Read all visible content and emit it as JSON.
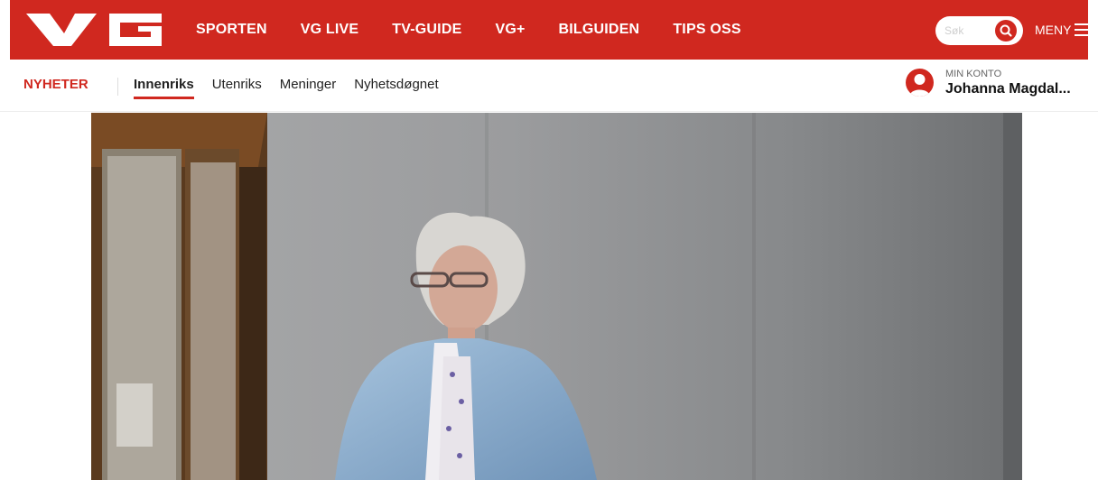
{
  "brand": {
    "name": "VG",
    "accent": "#d0281f"
  },
  "topnav": {
    "items": [
      {
        "label": "SPORTEN"
      },
      {
        "label": "VG LIVE"
      },
      {
        "label": "TV-GUIDE"
      },
      {
        "label": "VG+"
      },
      {
        "label": "BILGUIDEN"
      },
      {
        "label": "TIPS OSS"
      }
    ]
  },
  "search": {
    "placeholder": "Søk",
    "value": "",
    "icon": "search-icon"
  },
  "menu": {
    "label": "MENY",
    "icon": "hamburger-icon"
  },
  "subnav": {
    "section": "NYHETER",
    "tabs": [
      {
        "label": "Innenriks",
        "active": true
      },
      {
        "label": "Utenriks"
      },
      {
        "label": "Meninger"
      },
      {
        "label": "Nyhetsdøgnet"
      }
    ]
  },
  "account": {
    "label": "MIN KONTO",
    "name": "Johanna Magdal...",
    "icon": "user-avatar-icon"
  },
  "hero": {
    "image": "photo-elderly-woman-by-window"
  }
}
